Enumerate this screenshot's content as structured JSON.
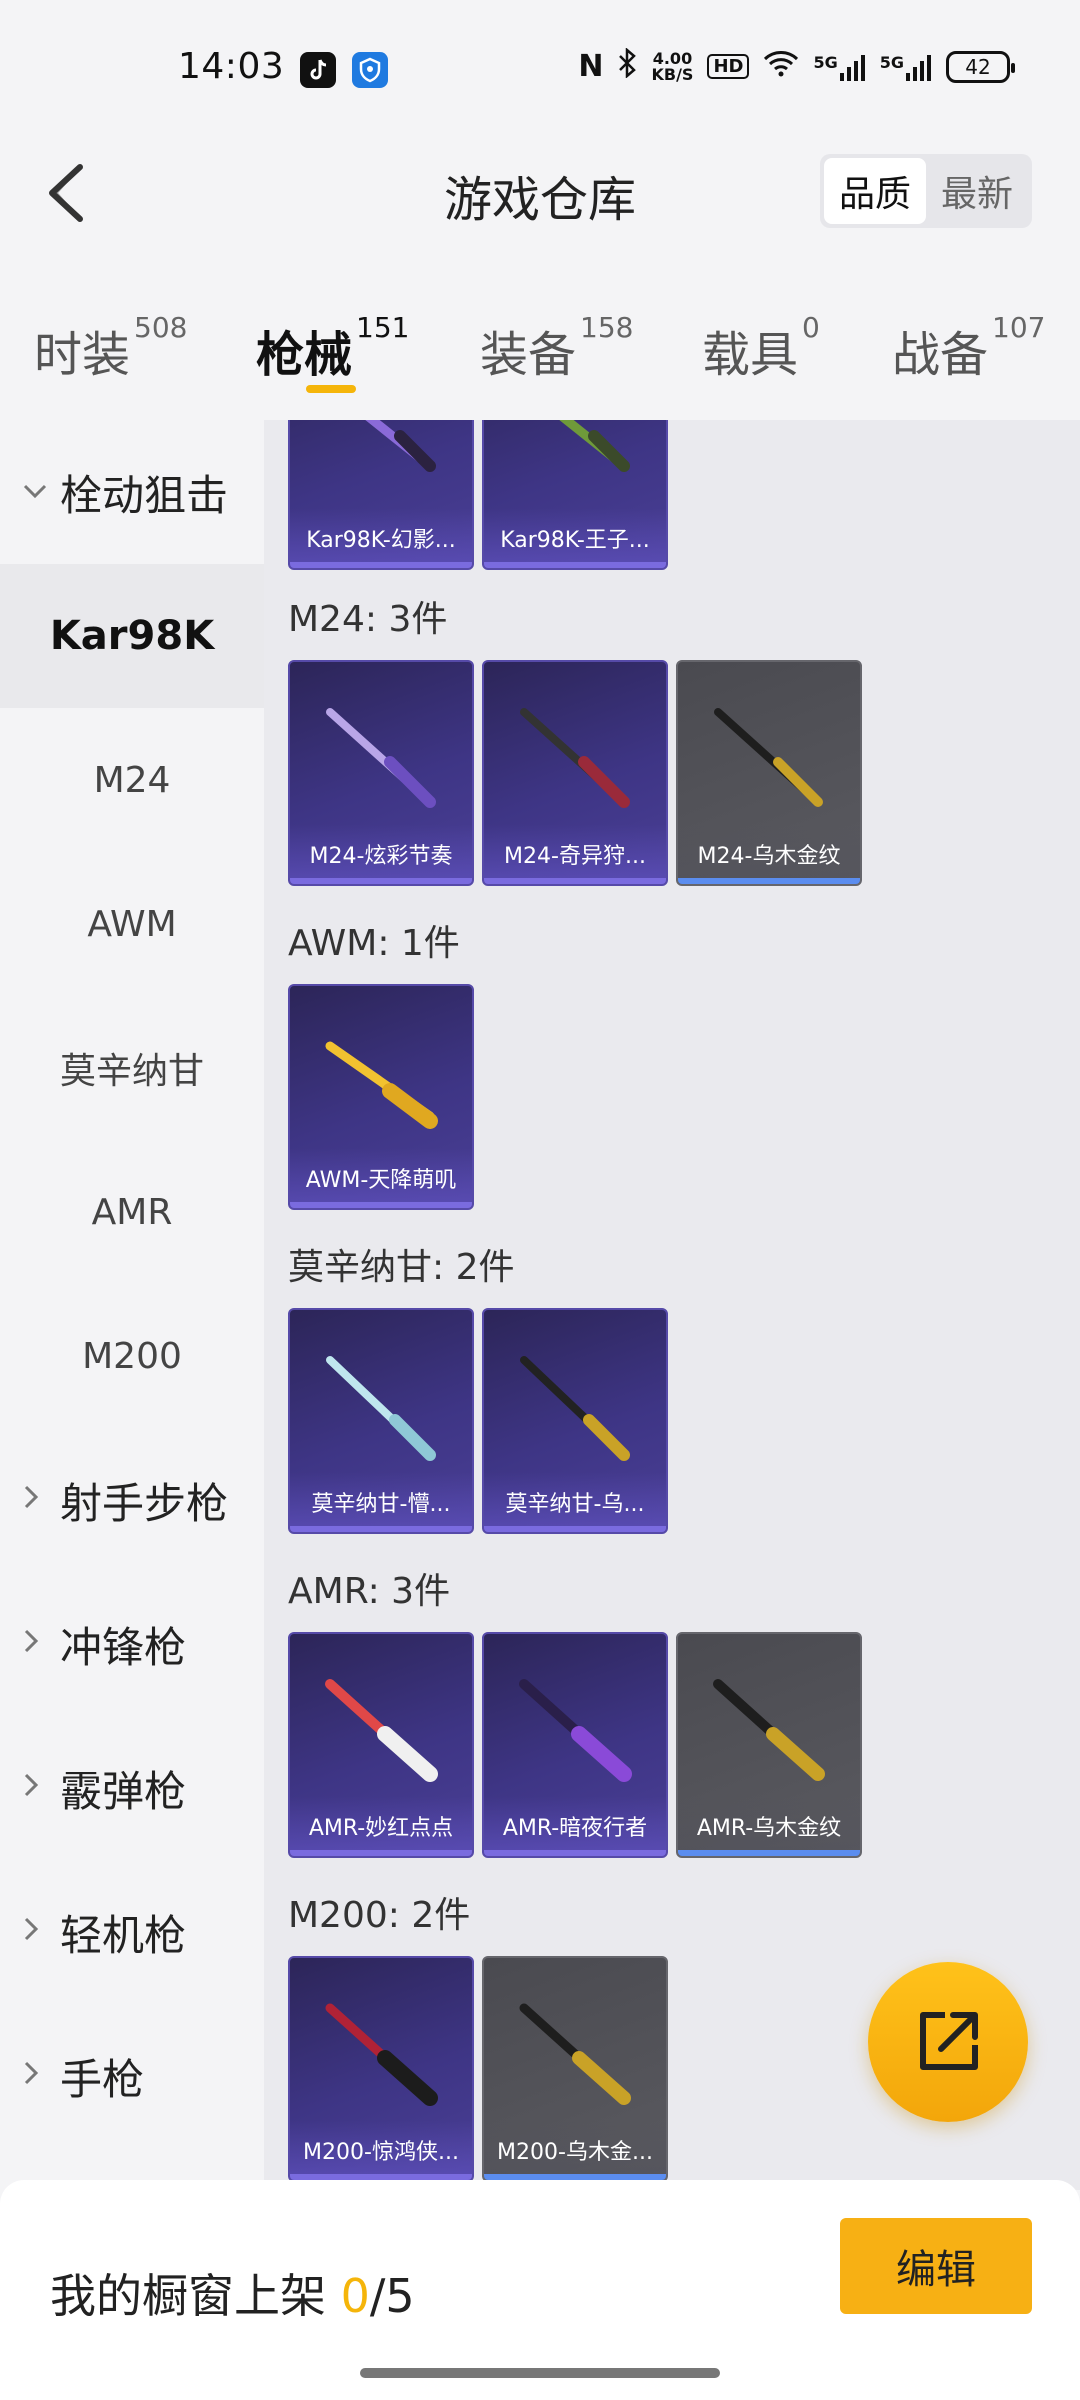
{
  "status_bar": {
    "time": "14:03",
    "speed": "4.00",
    "speed_unit": "KB/S",
    "hd": "HD",
    "net1": "5G",
    "net2": "5G",
    "battery": "42"
  },
  "header": {
    "title": "游戏仓库",
    "sort_options": [
      "品质",
      "最新"
    ]
  },
  "tabs": [
    {
      "label": "时装",
      "count": "508"
    },
    {
      "label": "枪械",
      "count": "151"
    },
    {
      "label": "装备",
      "count": "158"
    },
    {
      "label": "载具",
      "count": "0"
    },
    {
      "label": "战备",
      "count": "107"
    }
  ],
  "sidebar": {
    "group_open": "栓动狙击",
    "sub_items": [
      "Kar98K",
      "M24",
      "AWM",
      "莫辛纳甘",
      "AMR",
      "M200"
    ],
    "groups": [
      "射手步枪",
      "冲锋枪",
      "霰弹枪",
      "轻机枪",
      "手枪"
    ]
  },
  "sections": [
    {
      "label": "",
      "items": [
        "Kar98K-幻影...",
        "Kar98K-王子..."
      ]
    },
    {
      "label": "M24: 3件",
      "items": [
        "M24-炫彩节奏",
        "M24-奇异狩...",
        "M24-乌木金纹"
      ]
    },
    {
      "label": "AWM: 1件",
      "items": [
        "AWM-天降萌叽"
      ]
    },
    {
      "label": "莫辛纳甘: 2件",
      "items": [
        "莫辛纳甘-懵...",
        "莫辛纳甘-乌..."
      ]
    },
    {
      "label": "AMR: 3件",
      "items": [
        "AMR-妙红点点",
        "AMR-暗夜行者",
        "AMR-乌木金纹"
      ]
    },
    {
      "label": "M200: 2件",
      "items": [
        "M200-惊鸿侠...",
        "M200-乌木金..."
      ]
    }
  ],
  "bottom": {
    "label": "我的橱窗上架 ",
    "count": "0",
    "total": "/5",
    "edit": "编辑"
  },
  "colors": {
    "accent": "#f5b50a",
    "card_purple": "#3e3585",
    "card_grey": "#55555b"
  }
}
